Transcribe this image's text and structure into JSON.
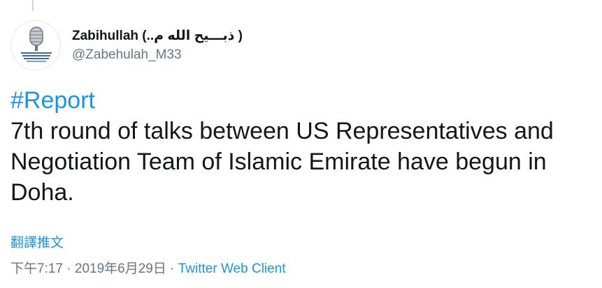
{
  "author": {
    "display_name": "Zabihullah (..ذبـــیح الله م )",
    "handle": "@Zabehulah_M33"
  },
  "tweet": {
    "hashtag": "#Report",
    "body": "7th round of talks between US Representatives and Negotiation Team of Islamic Emirate have begun in Doha."
  },
  "translate_label": "翻譯推文",
  "meta": {
    "time": "下午7:17",
    "separator": " · ",
    "date": "2019年6月29日",
    "client": "Twitter Web Client"
  },
  "colors": {
    "link": "#1b95e0",
    "muted": "#657786",
    "text": "#14171a"
  },
  "icons": {
    "avatar": "microphone-logo"
  }
}
